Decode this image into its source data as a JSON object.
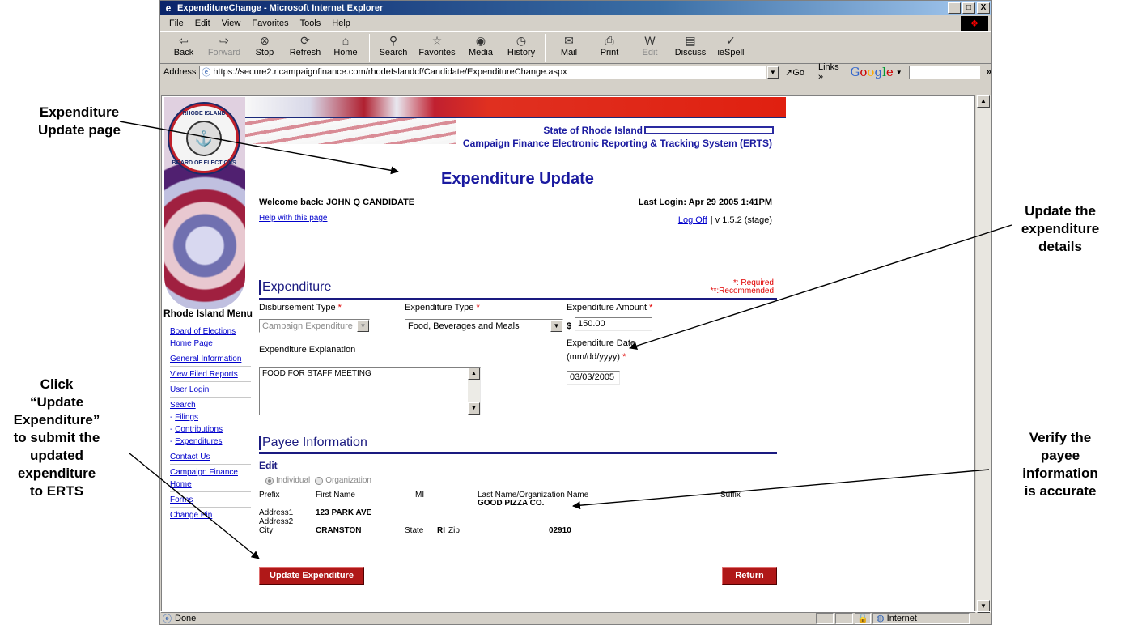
{
  "callouts": {
    "expenditure_update_page": "Expenditure\nUpdate page",
    "update_details": "Update the\nexpenditure\ndetails",
    "click_update": "Click\n“Update\nExpenditure”\nto submit the\nupdated\nexpenditure\nto ERTS",
    "verify_payee": "Verify the\npayee\ninformation\nis accurate"
  },
  "window": {
    "title": "ExpenditureChange - Microsoft Internet Explorer",
    "min": "_",
    "max": "□",
    "close": "X"
  },
  "menu": [
    "File",
    "Edit",
    "View",
    "Favorites",
    "Tools",
    "Help"
  ],
  "toolbar": {
    "back": "Back",
    "forward": "Forward",
    "stop": "Stop",
    "refresh": "Refresh",
    "home": "Home",
    "search": "Search",
    "favorites": "Favorites",
    "media": "Media",
    "history": "History",
    "mail": "Mail",
    "print": "Print",
    "edit": "Edit",
    "discuss": "Discuss",
    "iespell": "ieSpell"
  },
  "address": {
    "label": "Address",
    "url": "https://secure2.ricampaignfinance.com/rhodeIslandcf/Candidate/ExpenditureChange.aspx",
    "go": "Go",
    "links": "Links",
    "google": "Google"
  },
  "status": {
    "text": "Done",
    "zone": "Internet"
  },
  "page": {
    "seal_top": "RHODE ISLAND",
    "seal_bottom": "BOARD OF ELECTIONS",
    "state": "State of Rhode Island",
    "system": "Campaign Finance Electronic Reporting & Tracking System (ERTS)",
    "title": "Expenditure Update",
    "welcome": "Welcome back: JOHN Q CANDIDATE",
    "last_login": "Last Login: Apr 29 2005 1:41PM",
    "help": "Help with this page",
    "logoff": "Log Off",
    "version": "| v 1.5.2 (stage)"
  },
  "left_menu": {
    "title": "Rhode Island Menu",
    "board1": "Board of Elections",
    "board2": "Home Page",
    "general": "General Information",
    "filed": "View Filed Reports",
    "login": "User Login",
    "search": "Search",
    "filings": "Filings",
    "contributions": "Contributions",
    "expenditures": "Expenditures",
    "contact": "Contact Us",
    "cf1": "Campaign Finance",
    "cf2": "Home",
    "forms": "Forms",
    "pin": "Change Pin"
  },
  "expenditure": {
    "heading": "Expenditure",
    "required": "*: Required",
    "recommended": "**:Recommended",
    "disbursement_label": "Disbursement Type",
    "disbursement_value": "Campaign Expenditure",
    "type_label": "Expenditure Type",
    "type_value": "Food, Beverages and Meals",
    "amount_label": "Expenditure Amount",
    "currency": "$",
    "amount_value": "150.00",
    "explanation_label": "Expenditure Explanation",
    "explanation_value": "FOOD FOR STAFF MEETING",
    "date_label": "Expenditure Date",
    "date_format": "(mm/dd/yyyy)",
    "date_value": "03/03/2005",
    "star": "*"
  },
  "payee": {
    "heading": "Payee Information",
    "edit": "Edit",
    "individual": "Individual",
    "organization": "Organization",
    "prefix": "Prefix",
    "first_name": "First Name",
    "mi": "MI",
    "last_name": "Last Name/Organization Name",
    "last_name_value": "GOOD PIZZA CO.",
    "suffix": "Suffix",
    "address1": "Address1",
    "address1_value": "123 PARK AVE",
    "address2": "Address2",
    "city": "City",
    "city_value": "CRANSTON",
    "state": "State",
    "state_value": "RI",
    "zip": "Zip",
    "zip_value": "02910"
  },
  "buttons": {
    "update": "Update Expenditure",
    "return": "Return"
  }
}
